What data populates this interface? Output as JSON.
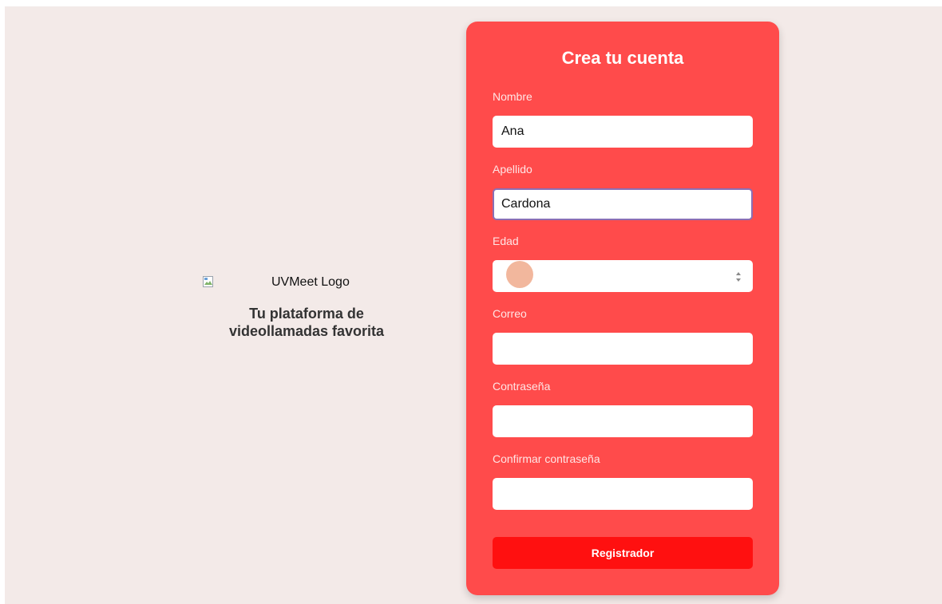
{
  "brand": {
    "logo_alt": "UVMeet Logo",
    "tagline_line1": "Tu plataforma de",
    "tagline_line2": "videollamadas favorita"
  },
  "form": {
    "title": "Crea tu cuenta",
    "fields": {
      "nombre": {
        "label": "Nombre",
        "value": "Ana"
      },
      "apellido": {
        "label": "Apellido",
        "value": "Cardona"
      },
      "edad": {
        "label": "Edad",
        "value": ""
      },
      "correo": {
        "label": "Correo",
        "value": ""
      },
      "contrasena": {
        "label": "Contraseña",
        "value": ""
      },
      "confirmar": {
        "label": "Confirmar contraseña",
        "value": ""
      }
    },
    "submit_label": "Registrador"
  },
  "colors": {
    "page_bg": "#f3eae8",
    "card_bg": "#ff4b4b",
    "button_bg": "#ff1010",
    "focus_border": "#8a6fb5"
  },
  "icons": {
    "broken_image": "broken-image-icon",
    "number_spinner": "spinner-arrows-icon"
  }
}
